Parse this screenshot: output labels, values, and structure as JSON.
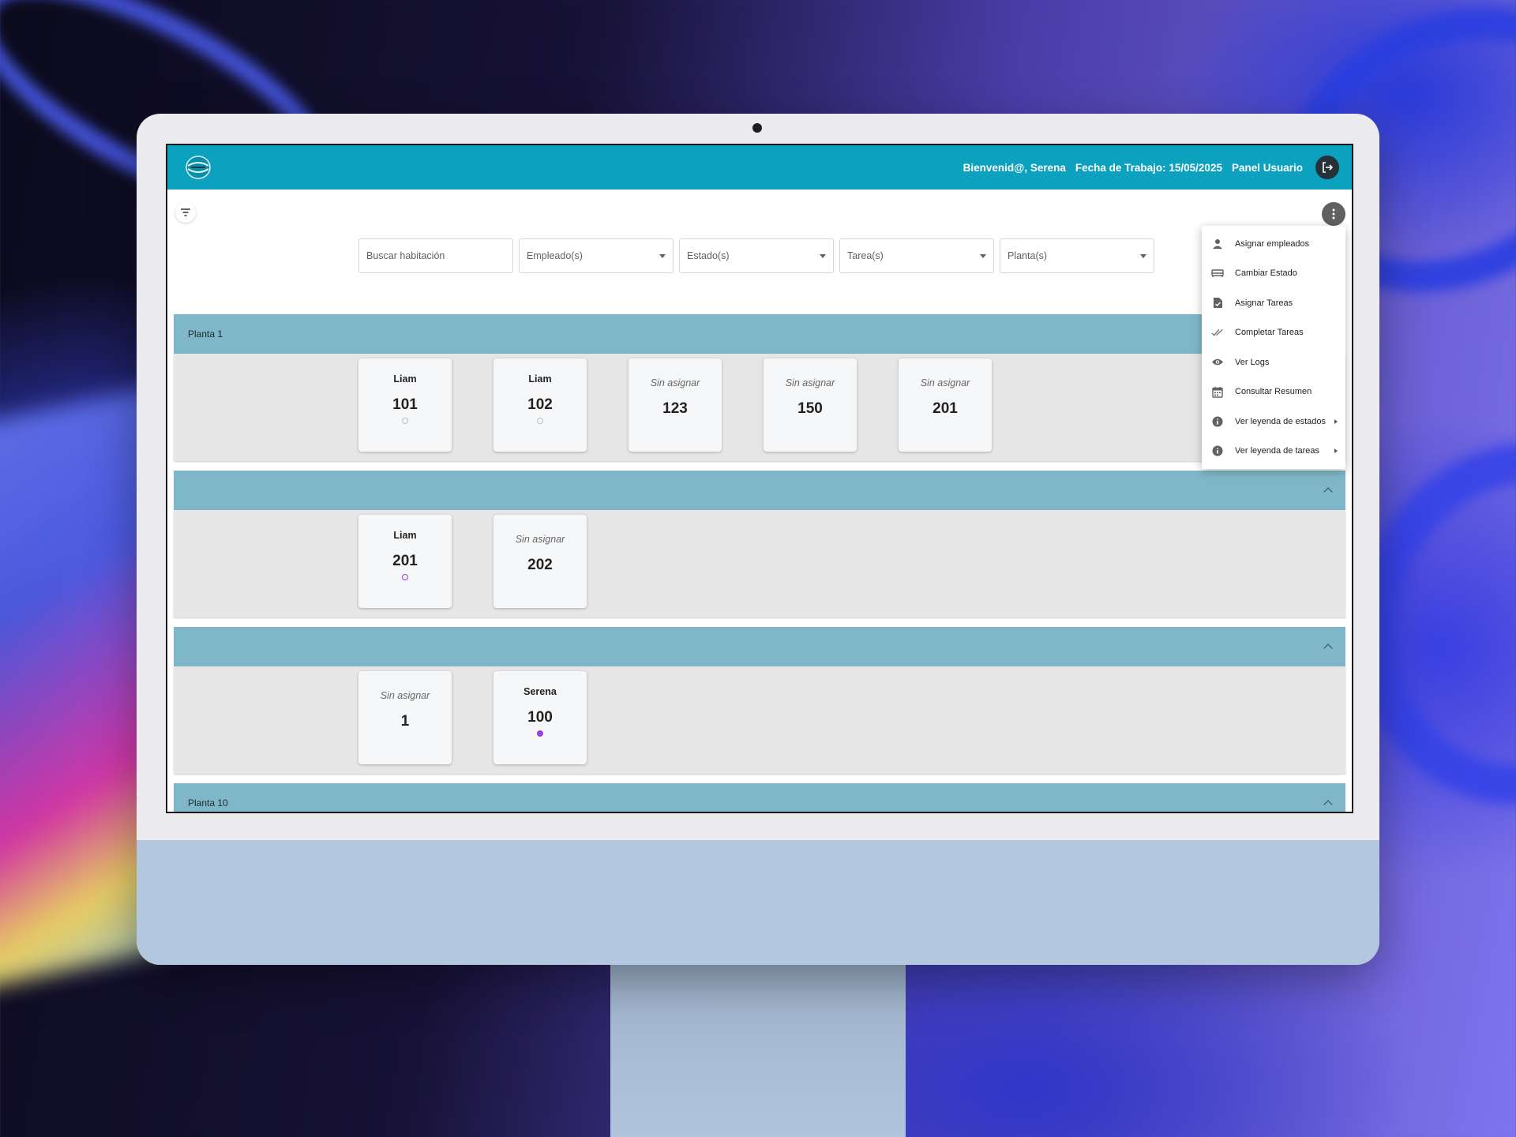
{
  "header": {
    "greeting": "Bienvenid@, Serena",
    "work_date": "Fecha de Trabajo: 15/05/2025",
    "panel": "Panel Usuario"
  },
  "filters": {
    "search_placeholder": "Buscar habitación",
    "employees": "Empleado(s)",
    "states": "Estado(s)",
    "tasks": "Tarea(s)",
    "floors": "Planta(s)"
  },
  "menu": {
    "items": [
      {
        "label": "Asignar empleados",
        "icon": "person-icon"
      },
      {
        "label": "Cambiar Estado",
        "icon": "bed-icon"
      },
      {
        "label": "Asignar Tareas",
        "icon": "task-file-icon"
      },
      {
        "label": "Completar Tareas",
        "icon": "double-check-icon"
      },
      {
        "label": "Ver Logs",
        "icon": "eye-icon"
      },
      {
        "label": "Consultar Resumen",
        "icon": "calendar-icon"
      },
      {
        "label": "Ver leyenda de estados",
        "icon": "info-icon"
      },
      {
        "label": "Ver leyenda de tareas",
        "icon": "info-icon"
      }
    ]
  },
  "sections": [
    {
      "title": "Planta 1",
      "rooms": [
        {
          "employee": "Liam",
          "number": "101",
          "status": "empty"
        },
        {
          "employee": "Liam",
          "number": "102",
          "status": "empty"
        },
        {
          "employee": "Sin asignar",
          "number": "123",
          "status": "none"
        },
        {
          "employee": "Sin asignar",
          "number": "150",
          "status": "none"
        },
        {
          "employee": "Sin asignar",
          "number": "201",
          "status": "none"
        }
      ]
    },
    {
      "title": "",
      "rooms": [
        {
          "employee": "Liam",
          "number": "201",
          "status": "purple-ring"
        },
        {
          "employee": "Sin asignar",
          "number": "202",
          "status": "none"
        }
      ]
    },
    {
      "title": "",
      "rooms": [
        {
          "employee": "Sin asignar",
          "number": "1",
          "status": "none"
        },
        {
          "employee": "Serena",
          "number": "100",
          "status": "purple"
        }
      ]
    },
    {
      "title": "Planta 10",
      "rooms": []
    }
  ],
  "colors": {
    "topbar": "#0ca1be",
    "section_header": "#7fb7c8",
    "status_purple": "#9c3ee0"
  }
}
